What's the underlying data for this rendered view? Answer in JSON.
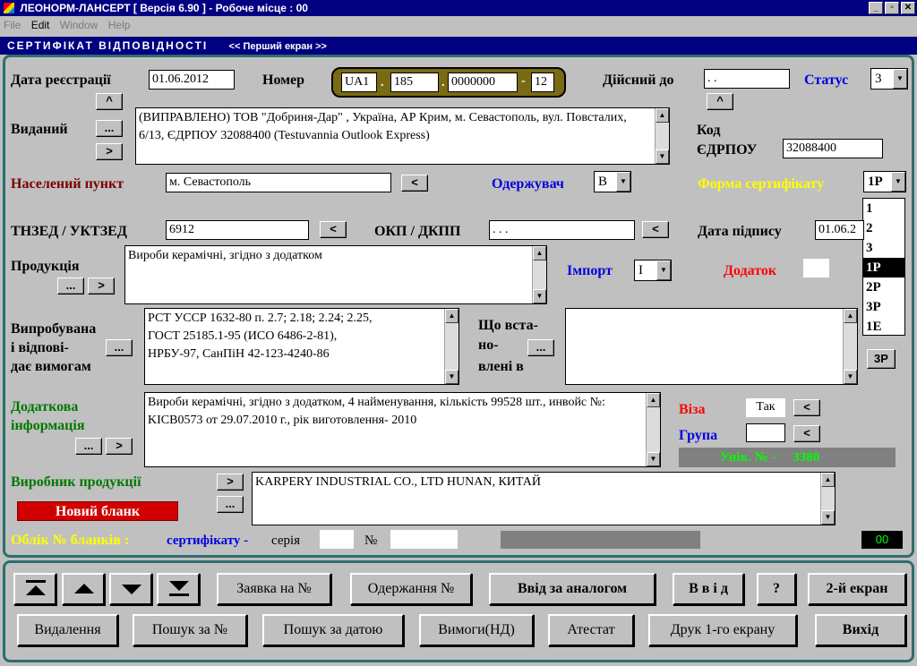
{
  "window": {
    "title": "ЛЕОНОРМ-ЛАНСЕРТ  [ Версія 6.90 ]  -  Робоче місце : 00",
    "controls": [
      "_",
      "▫",
      "✕"
    ]
  },
  "menu": [
    "File",
    "Edit",
    "Window",
    "Help"
  ],
  "banner": {
    "title": "СЕРТИФІКАТ ВІДПОВІДНОСТІ",
    "subtitle": "<< Перший екран >>"
  },
  "form": {
    "reg_date_label": "Дата реєстрації",
    "reg_date_value": "01.06.2012",
    "number_label": "Номер",
    "number_parts": [
      "UA1",
      "185",
      "0000000",
      "12"
    ],
    "number_seps": [
      ".",
      ".",
      "-"
    ],
    "valid_until_label": "Дійсний до",
    "valid_until_value": ". .",
    "status_label": "Статус",
    "status_value": "3",
    "issued_label": "Виданий",
    "issued_text": "(ВИПРАВЛЕНО) ТОВ \"Добриня-Дар\" , Україна, АР Крим, м. Севастополь, вул. Повсталих, 6/13, ЄДРПОУ 32088400 (Testuvannia Outlook Express)",
    "edrpou_label_1": "Код",
    "edrpou_label_2": "ЄДРПОУ",
    "edrpou_value": "32088400",
    "locality_label": "Населений пункт",
    "locality_value": "м. Севастополь",
    "recipient_label": "Одержувач",
    "recipient_value": "В",
    "cert_form_label": "Форма сертифікату",
    "cert_form_value": "1Р",
    "cert_form_options": [
      "1",
      "2",
      "3",
      "1Р",
      "2Р",
      "3Р",
      "1Е"
    ],
    "cert_form_selected": "1Р",
    "tnzed_label": "ТНЗЕД / УКТЗЕД",
    "tnzed_value": "6912",
    "okp_label": "ОКП / ДКПП",
    "okp_value": ". . .",
    "sign_date_label": "Дата підпису",
    "sign_date_value": "01.06.2",
    "product_label": "Продукція",
    "product_text": "Вироби керамічні, згідно з додатком",
    "import_label": "Імпорт",
    "import_value": "І",
    "addendum_label": "Додаток",
    "tested_label_1": "Випробувана",
    "tested_label_2": "і відпові-",
    "tested_label_3": "дає вимогам",
    "tested_text": "РСТ УССР 1632-80  п. 2.7; 2.18;  2.24; 2.25,\nГОСТ 25185.1-95 (ИСО 6486-2-81),\nНРБУ-97, СанПіН 42-123-4240-86",
    "established_label_1": "Що вста-",
    "established_label_2": "но-",
    "established_label_3": "влені в",
    "extra_info_label_1": "Додаткова",
    "extra_info_label_2": "інформація",
    "extra_info_text": "Вироби керамічні, згідно з додатком, 4 найменування, кількість 99528 шт., инвойс  №: KICB0573 от 29.07.2010 г., рік виготовлення- 2010",
    "visa_label": "Віза",
    "visa_value": "Так",
    "group_label": "Група",
    "unique_text": "Унік. № -     3380",
    "manufacturer_label": "Виробник продукції",
    "manufacturer_text": "KARPERY INDUSTRIAL CO., LTD HUNAN, КИТАЙ",
    "new_blank_label": "Новий бланк",
    "blanks_label": "Облік № бланків :",
    "cert_sub_label": "сертифікату -",
    "series_label": "серія",
    "no_label": "№",
    "counter": "00",
    "btn_3p": "3Р"
  },
  "small_buttons": {
    "up": "^",
    "dots": "...",
    "next": ">",
    "back": "<"
  },
  "toolbar": {
    "row1": [
      "Заявка на №",
      "Одержання №",
      "Ввід за аналогом",
      "В в і д",
      "?",
      "2-й екран"
    ],
    "row2": [
      "Видалення",
      "Пошук за №",
      "Пошук за датою",
      "Вимоги(НД)",
      "Атестат",
      "Друк 1-го екрану",
      "Вихід"
    ]
  }
}
